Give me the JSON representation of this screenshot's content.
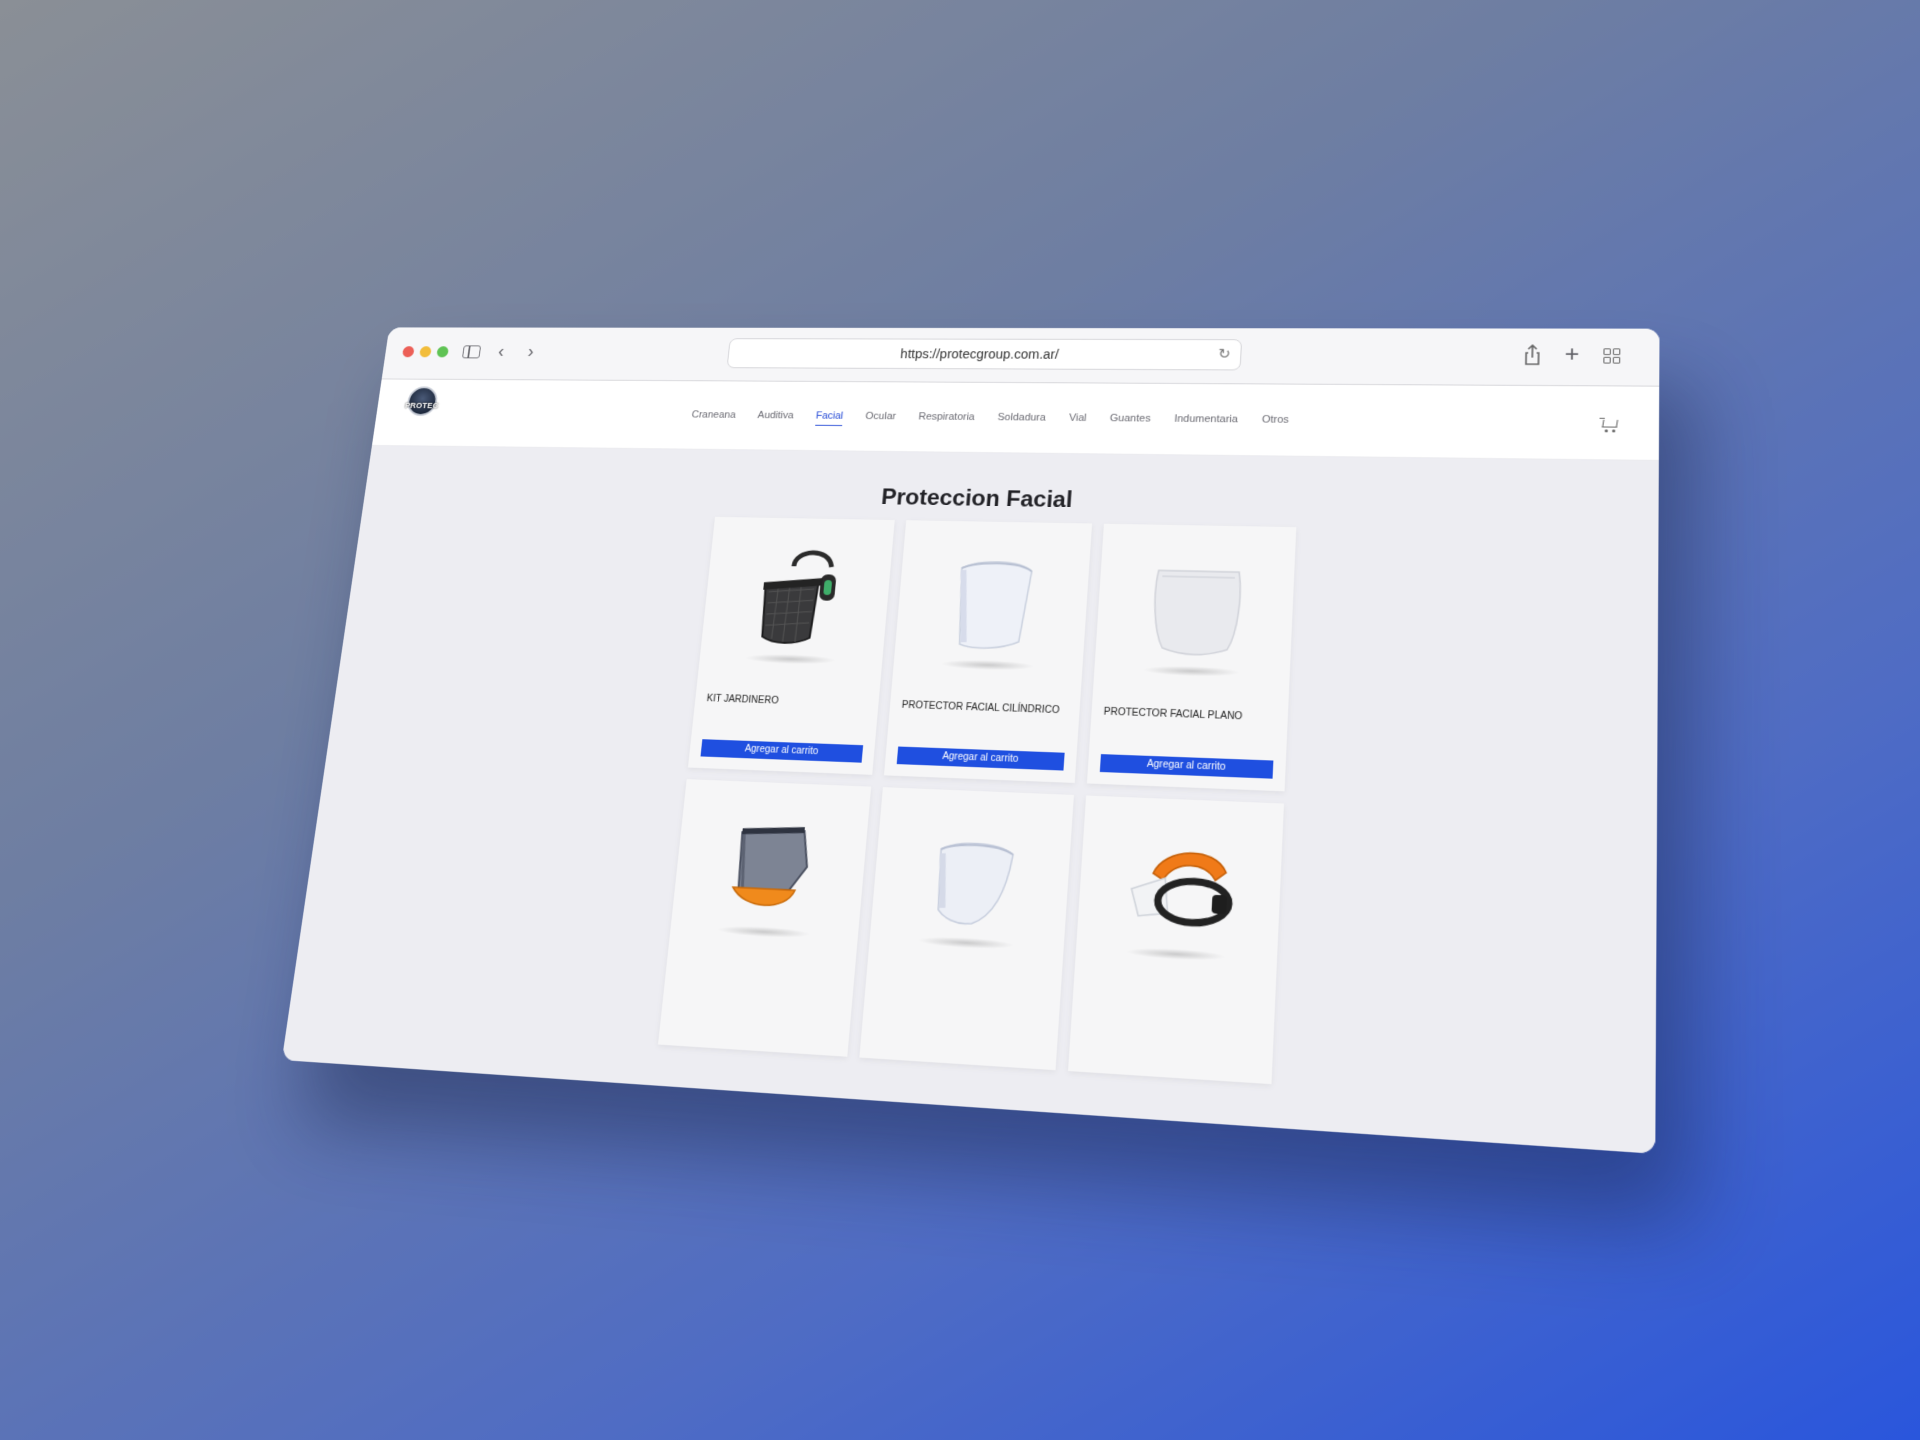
{
  "browser": {
    "url": "https://protecgroup.com.ar/"
  },
  "site": {
    "logo_text": "PROTEC",
    "nav": [
      {
        "label": "Craneana"
      },
      {
        "label": "Auditiva"
      },
      {
        "label": "Facial",
        "active": true
      },
      {
        "label": "Ocular"
      },
      {
        "label": "Respiratoria"
      },
      {
        "label": "Soldadura"
      },
      {
        "label": "Vial"
      },
      {
        "label": "Guantes"
      },
      {
        "label": "Indumentaria"
      },
      {
        "label": "Otros"
      }
    ]
  },
  "page": {
    "title": "Proteccion Facial",
    "add_label": "Agregar al carrito",
    "products": [
      {
        "name": "KIT JARDINERO",
        "image": "mesh-face-shield-with-earmuffs"
      },
      {
        "name": "PROTECTOR FACIAL CILÍNDRICO",
        "image": "cylindrical-clear-visor"
      },
      {
        "name": "PROTECTOR FACIAL PLANO",
        "image": "flat-clear-visor"
      },
      {
        "name": "",
        "image": "visor-with-orange-brow-guard"
      },
      {
        "name": "",
        "image": "clear-curved-visor"
      },
      {
        "name": "",
        "image": "orange-headgear-with-visor"
      }
    ]
  },
  "colors": {
    "accent": "#1f4fe0",
    "active_nav": "#2449d6",
    "background_gradient_end": "#2a56dc"
  },
  "icons": [
    "sidebar-toggle-icon",
    "chevron-left-icon",
    "chevron-right-icon",
    "reload-icon",
    "share-icon",
    "plus-icon",
    "tab-overview-icon",
    "cart-icon"
  ]
}
